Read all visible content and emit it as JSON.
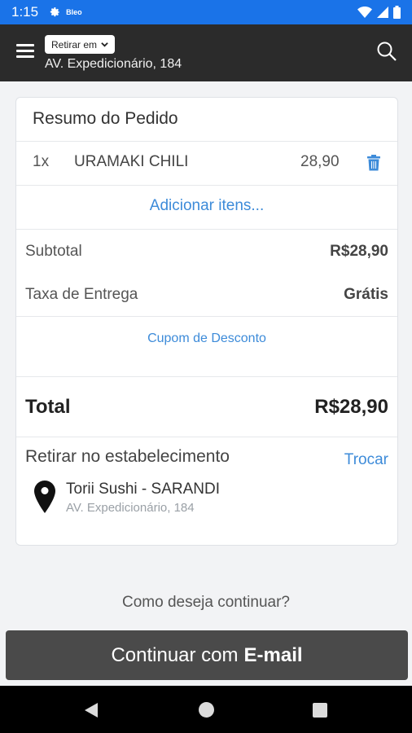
{
  "status_bar": {
    "time": "1:15",
    "label": "Bleo",
    "icons": [
      "gear-icon",
      "wifi-icon",
      "signal-icon",
      "battery-icon"
    ]
  },
  "app_bar": {
    "pickup_select_value": "Retirar em",
    "address": "AV. Expedicionário, 184"
  },
  "order_summary": {
    "title": "Resumo do Pedido",
    "items": [
      {
        "qty": "1x",
        "name": "URAMAKI CHILI",
        "price": "28,90"
      }
    ],
    "add_items_label": "Adicionar itens...",
    "subtotal_label": "Subtotal",
    "subtotal_value": "R$28,90",
    "delivery_label": "Taxa de Entrega",
    "delivery_value": "Grátis",
    "coupon_label": "Cupom de Desconto",
    "total_label": "Total",
    "total_value": "R$28,90",
    "pickup_title": "Retirar no estabelecimento",
    "change_label": "Trocar",
    "store_name": "Torii Sushi - SARANDI",
    "store_address": "AV. Expedicionário, 184"
  },
  "footer": {
    "question": "Como deseja continuar?",
    "continue_prefix": "Continuar com",
    "continue_bold": "E-mail"
  },
  "colors": {
    "status_bar": "#1a73e8",
    "app_bar": "#2b2b2b",
    "link": "#3d8bd9",
    "continue_button": "#4a4a4a"
  }
}
